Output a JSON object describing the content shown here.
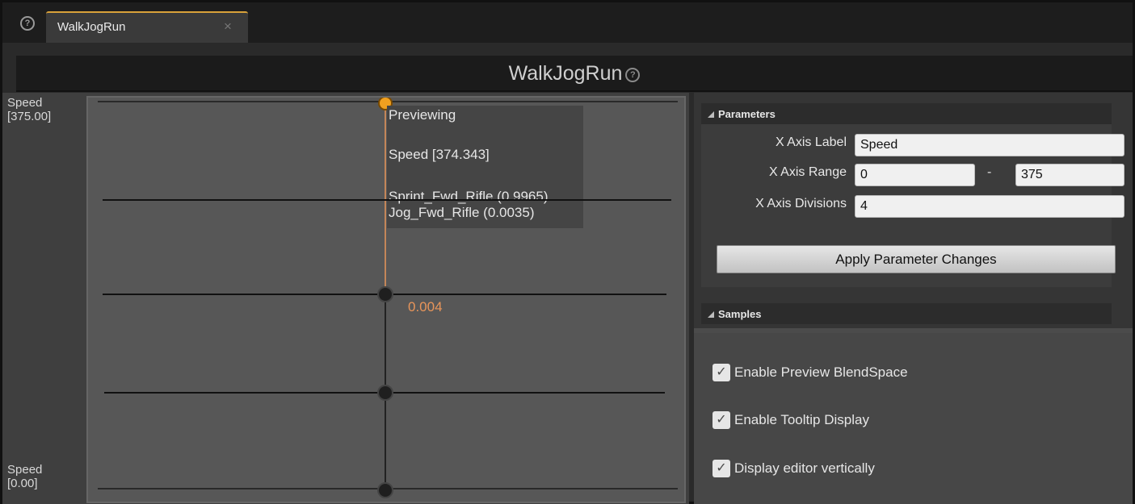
{
  "tab": {
    "title": "WalkJogRun",
    "close_glyph": "×",
    "help_glyph": "?"
  },
  "header": {
    "title": "WalkJogRun",
    "help_glyph": "?"
  },
  "graph": {
    "axis_max_label": "Speed\n[375.00]",
    "axis_min_label": "Speed\n[0.00]",
    "tooltip": {
      "heading": "Previewing",
      "speed": "Speed [374.343]",
      "sample1": "Sprint_Fwd_Rifle (0.9965)",
      "sample2": "Jog_Fwd_Rifle (0.0035)"
    },
    "weight_label": "0.004",
    "preview_color": "#e8955a",
    "marker_color": "#f0a020"
  },
  "parameters": {
    "heading": "Parameters",
    "x_axis_label": {
      "label": "X Axis Label",
      "value": "Speed"
    },
    "x_axis_range": {
      "label": "X Axis Range",
      "min": "0",
      "separator": "-",
      "max": "375"
    },
    "x_axis_divisions": {
      "label": "X Axis Divisions",
      "value": "4"
    },
    "apply_button": "Apply Parameter Changes"
  },
  "samples": {
    "heading": "Samples"
  },
  "options": [
    {
      "label": "Enable Preview BlendSpace",
      "checked": true
    },
    {
      "label": "Enable Tooltip Display",
      "checked": true
    },
    {
      "label": "Display editor vertically",
      "checked": true
    }
  ],
  "checkmark_glyph": "✓"
}
